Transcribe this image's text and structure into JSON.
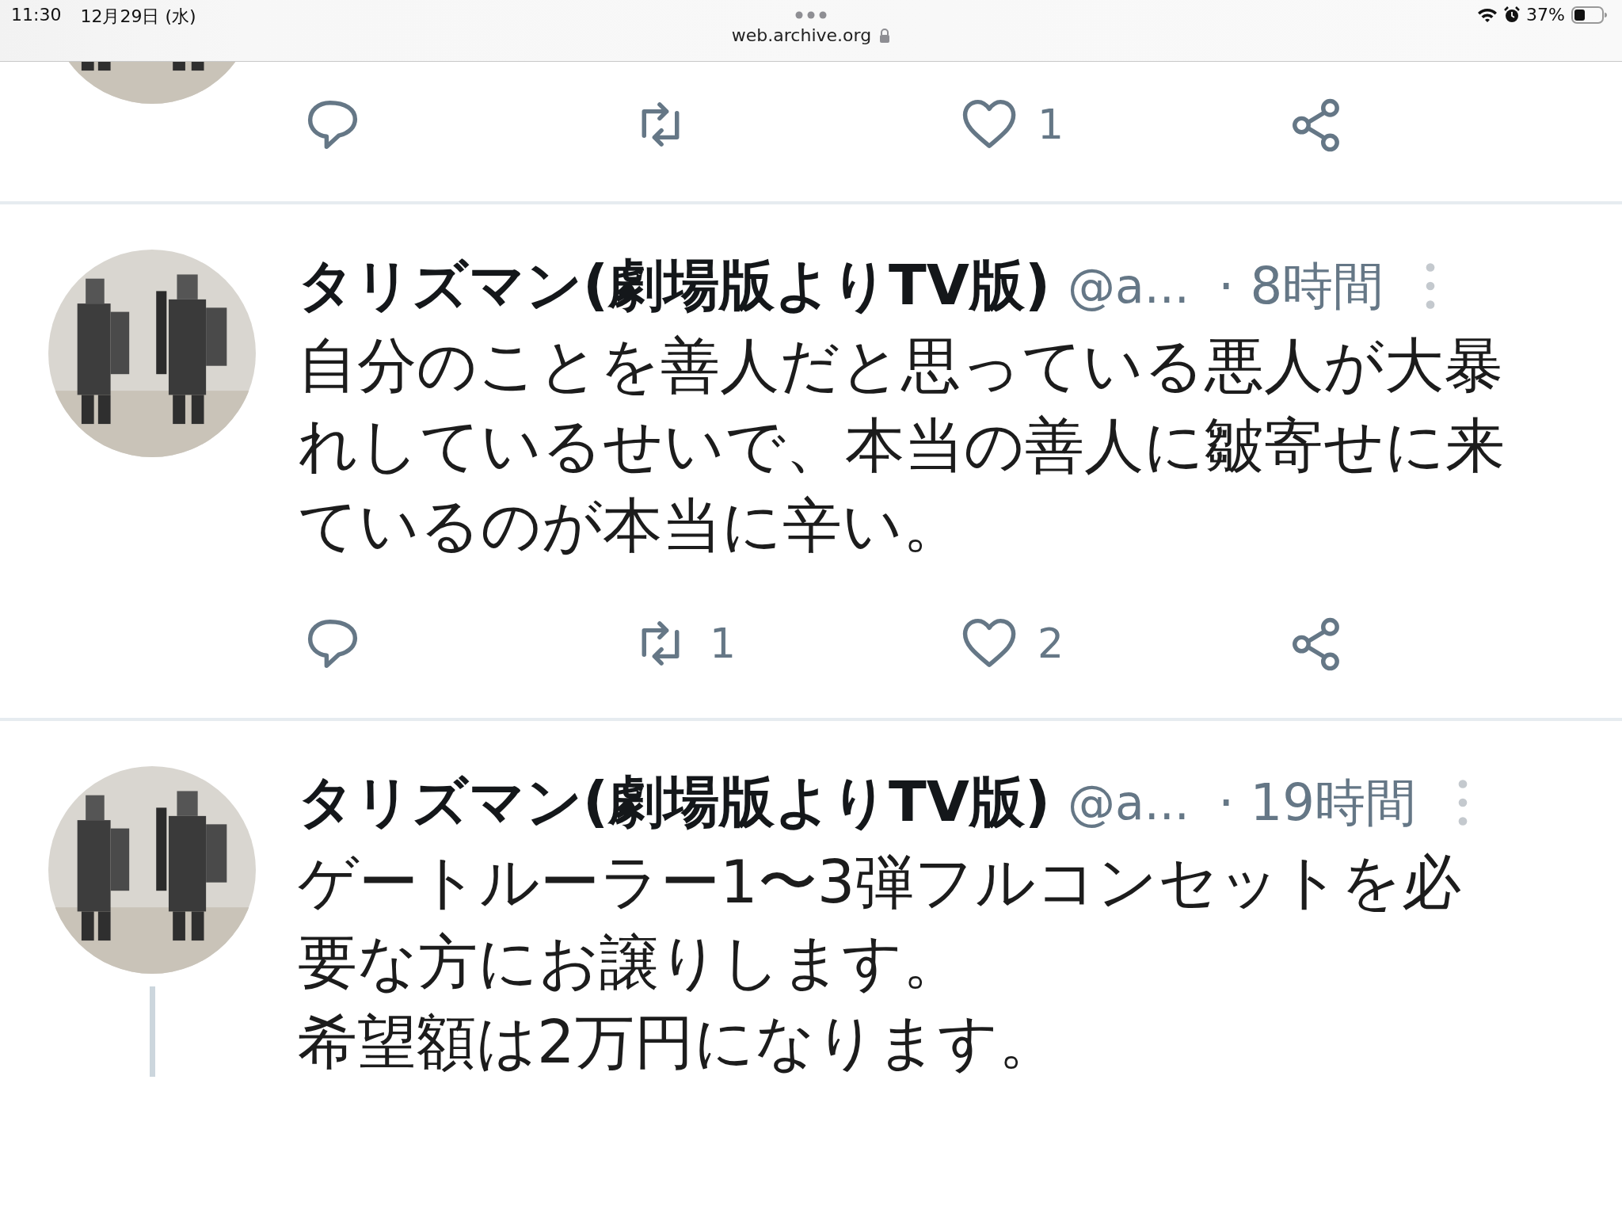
{
  "status_bar": {
    "time": "11:30",
    "date": "12月29日 (水)",
    "url": "web.archive.org",
    "battery": "37%"
  },
  "tweets": [
    {
      "kind": "cut",
      "avatar": {
        "kind": "picture"
      },
      "actions": [
        {
          "kind": "reply"
        },
        {
          "kind": "retweet"
        },
        {
          "kind": "like",
          "count": "1"
        },
        {
          "kind": "share"
        }
      ]
    },
    {
      "kind": "full",
      "avatar": {
        "kind": "picture"
      },
      "name": "タリズマン(劇場版よりTV版)",
      "handle": "@a...",
      "time": "· 8時間",
      "text": [
        "自分のことを善人だと思っている悪人が大暴れしているせいで、本当の善人に皺寄せに来ているのが本当に辛い。"
      ],
      "actions": [
        {
          "kind": "reply"
        },
        {
          "kind": "retweet",
          "count": "1"
        },
        {
          "kind": "like",
          "count": "2"
        },
        {
          "kind": "share"
        }
      ]
    },
    {
      "kind": "full",
      "avatar": {
        "kind": "picture"
      },
      "name": "タリズマン(劇場版よりTV版)",
      "handle": "@a...",
      "time": "· 19時間",
      "text": [
        "ゲートルーラー1〜3弾フルコンセットを必要な方にお譲りします。",
        "希望額は2万円になります。"
      ],
      "thread": true
    }
  ]
}
